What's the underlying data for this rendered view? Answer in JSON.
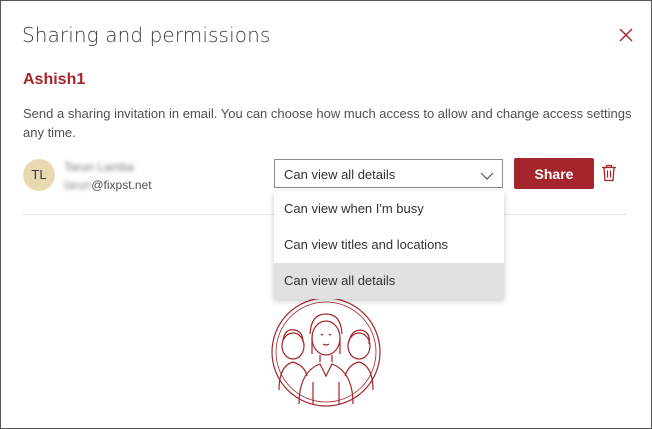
{
  "dialog": {
    "title": "Sharing and permissions",
    "calendar_name": "Ashish1",
    "description": "Send a sharing invitation in email. You can choose how much access to allow and change access settings any time."
  },
  "person": {
    "initials": "TL",
    "name": "Tarun Lamba",
    "email_user": "tarun",
    "email_domain": "@fixpst.net"
  },
  "permission": {
    "selected": "Can view all details",
    "options": [
      "Can view when I'm busy",
      "Can view titles and locations",
      "Can view all details"
    ],
    "highlighted_index": 2
  },
  "actions": {
    "share_label": "Share"
  },
  "colors": {
    "accent": "#a4262c",
    "avatar_bg": "#e8d9b0"
  },
  "icons": {
    "close": "close-icon",
    "chevron": "chevron-down-icon",
    "trash": "trash-icon",
    "illustration": "people-illustration"
  }
}
